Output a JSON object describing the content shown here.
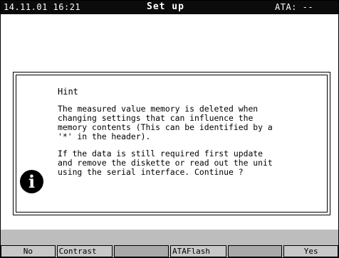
{
  "header": {
    "datetime": "14.11.01 16:21",
    "title": "Set up",
    "status": "ATA: --"
  },
  "dialog": {
    "title": "Hint",
    "icon": "info-icon",
    "message_part1": "The measured value memory is deleted when\nchanging settings that can influence the\nmemory contents (This can be identified by a\n'*' in the header).",
    "message_part2": "If the data is still required first update\nand remove the diskette or read out the unit\nusing the serial interface. Continue ?"
  },
  "softkeys": [
    "No",
    "Contrast",
    "",
    "ATAFlash",
    "",
    "Yes"
  ]
}
